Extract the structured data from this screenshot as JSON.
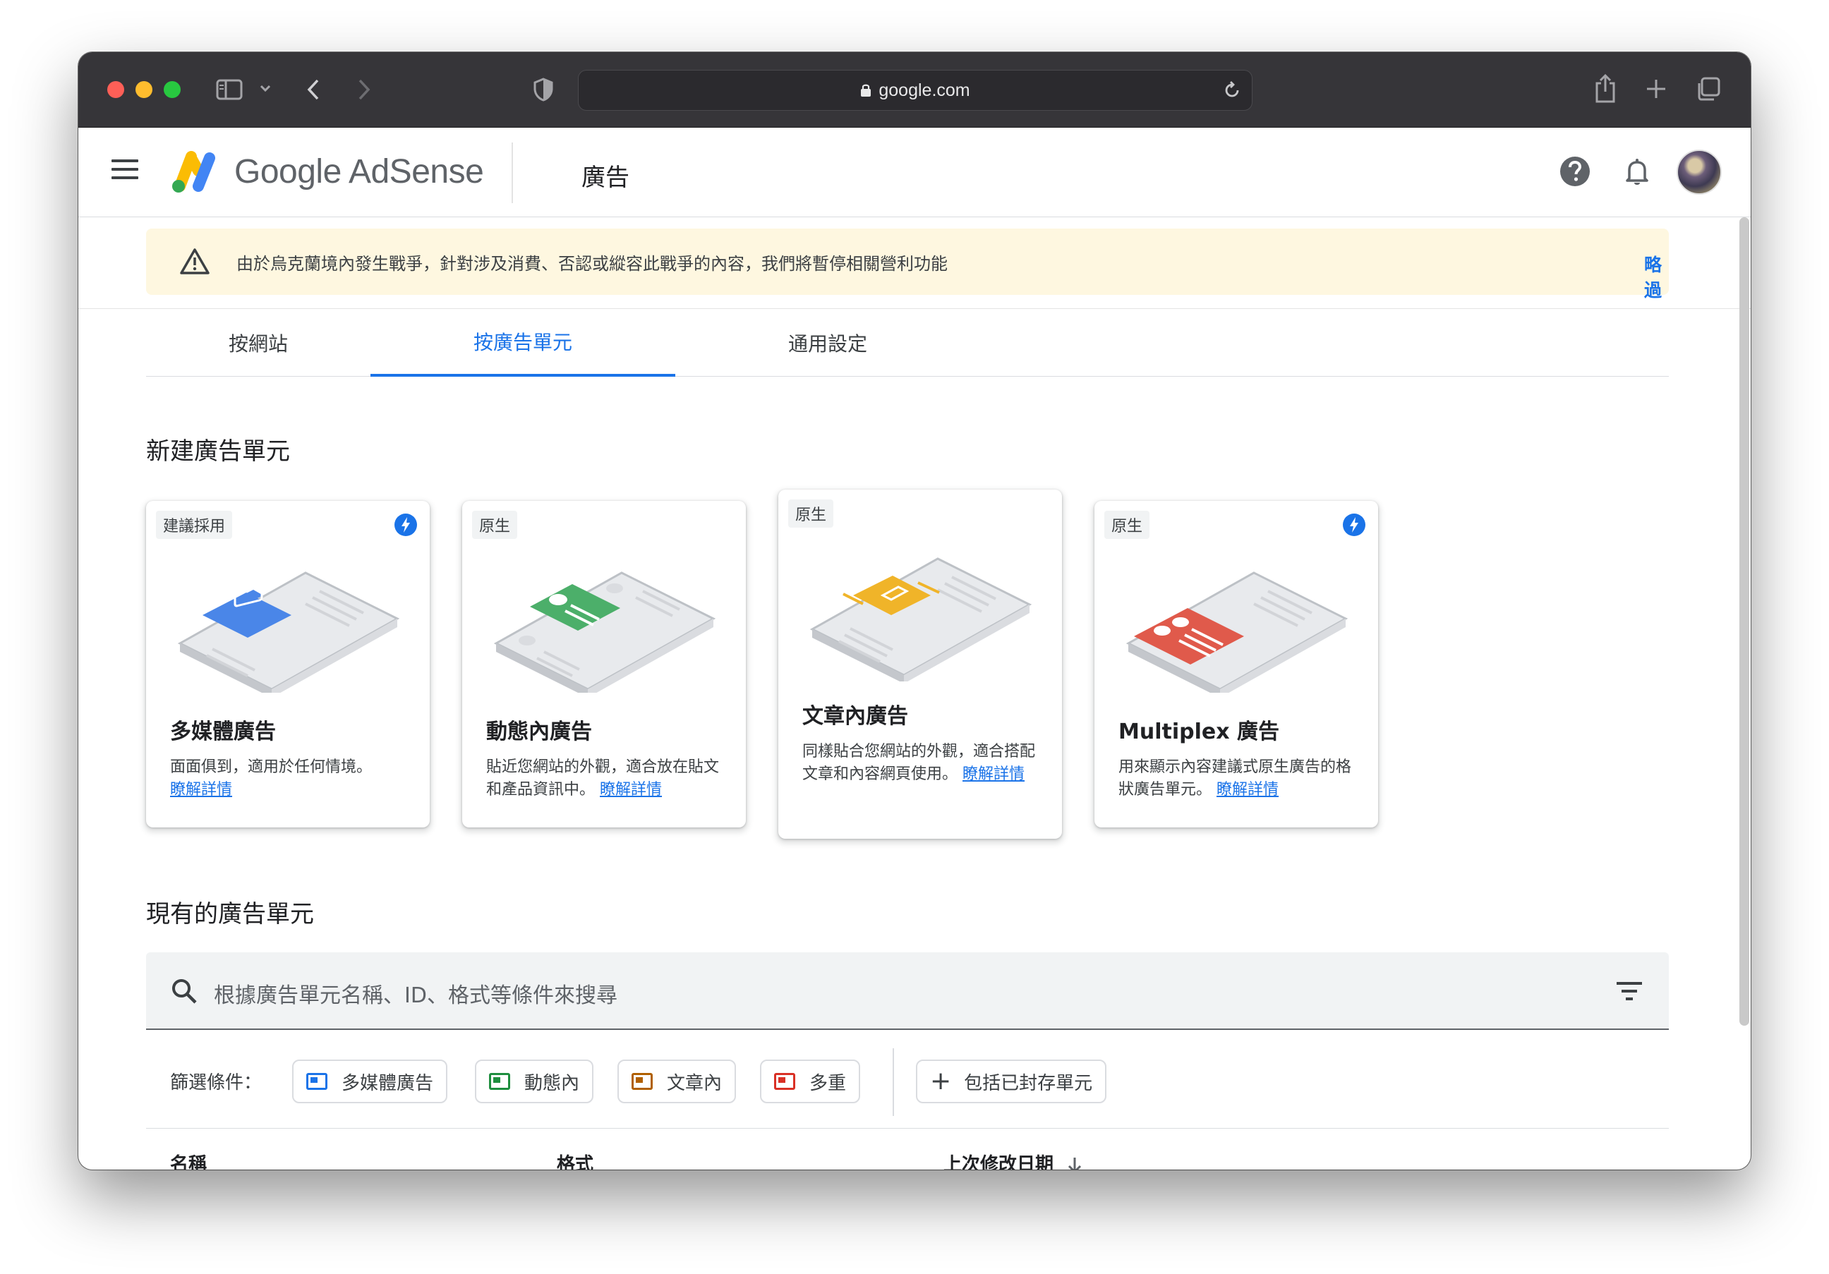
{
  "browser": {
    "url": "google.com"
  },
  "header": {
    "brand": "Google AdSense",
    "page_title": "廣告"
  },
  "banner": {
    "message": "由於烏克蘭境內發生戰爭，針對涉及消費、否認或縱容此戰爭的內容，我們將暫停相關營利功能",
    "skip_label": "略過"
  },
  "tabs": [
    {
      "label": "按網站"
    },
    {
      "label": "按廣告單元"
    },
    {
      "label": "通用設定"
    }
  ],
  "new_units": {
    "title": "新建廣告單元",
    "cards": [
      {
        "badge": "建議採用",
        "title": "多媒體廣告",
        "desc": "面面俱到，適用於任何情境。",
        "link": "瞭解詳情",
        "color": "#4a86e8"
      },
      {
        "badge": "原生",
        "title": "動態內廣告",
        "desc": "貼近您網站的外觀，適合放在貼文和產品資訊中。",
        "link": "瞭解詳情",
        "color": "#4caf6a"
      },
      {
        "badge": "原生",
        "title": "文章內廣告",
        "desc": "同樣貼合您網站的外觀，適合搭配文章和內容網頁使用。",
        "link": "瞭解詳情",
        "color": "#f0b429"
      },
      {
        "badge": "原生",
        "title": "Multiplex 廣告",
        "desc": "用來顯示內容建議式原生廣告的格狀廣告單元。",
        "link": "瞭解詳情",
        "color": "#e05a4b"
      }
    ]
  },
  "existing_units": {
    "title": "現有的廣告單元",
    "search_placeholder": "根據廣告單元名稱、ID、格式等條件來搜尋",
    "filter_label": "篩選條件：",
    "filters": [
      {
        "label": "多媒體廣告"
      },
      {
        "label": "動態內"
      },
      {
        "label": "文章內"
      },
      {
        "label": "多重"
      }
    ],
    "archived_label": "包括已封存單元",
    "columns": [
      {
        "label": "名稱"
      },
      {
        "label": "格式"
      },
      {
        "label": "上次修改日期"
      }
    ]
  }
}
